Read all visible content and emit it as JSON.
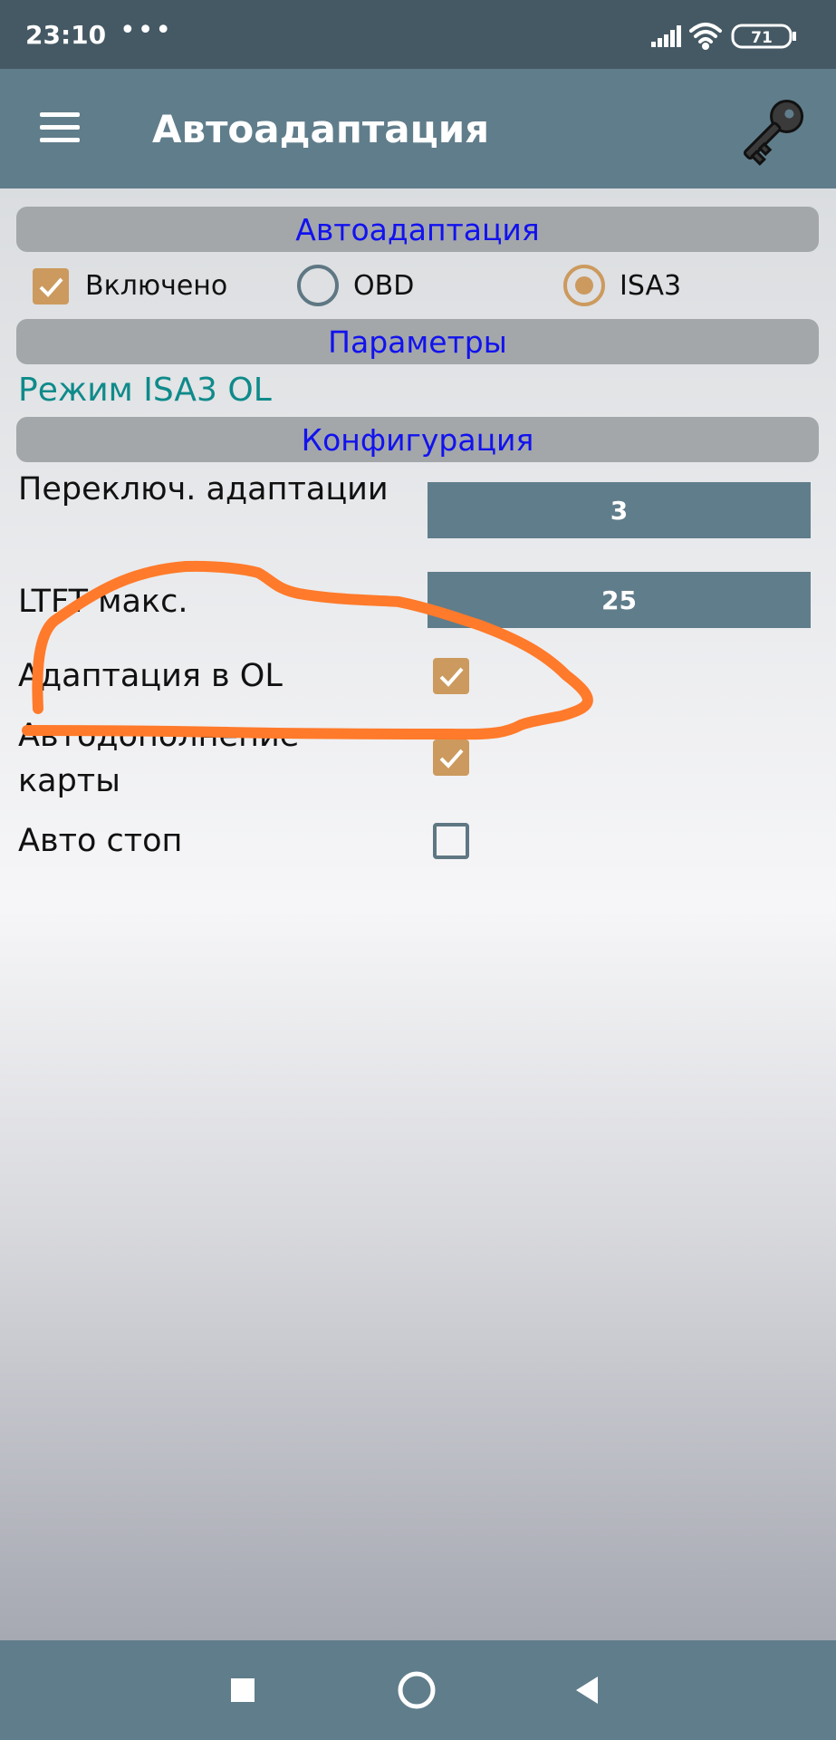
{
  "status_bar": {
    "time": "23:10",
    "dots": "•••",
    "battery": "71"
  },
  "app_bar": {
    "title": "Автоадаптация",
    "menu_icon": "hamburger-menu-icon",
    "action_icon": "key-icon"
  },
  "sections": {
    "autoadapt": "Автоадаптация",
    "params": "Параметры",
    "config": "Конфигурация"
  },
  "enable_row": {
    "enabled_label": "Включено",
    "enabled_checked": true,
    "obd_label": "OBD",
    "obd_selected": false,
    "isa3_label": "ISA3",
    "isa3_selected": true
  },
  "mode_text": "Режим ISA3 OL",
  "config": {
    "switch_label": "Переключ. адаптации",
    "switch_value": "3",
    "ltft_label": "LTFT макс.",
    "ltft_value": "25",
    "ol_label": "Адаптация в OL",
    "ol_checked": true,
    "map_label_line1": "Автодополнение",
    "map_label_line2": "карты",
    "map_checked": true,
    "autostop_label": "Авто стоп",
    "autostop_checked": false
  },
  "colors": {
    "app_bar": "#607d8b",
    "status_bar": "#455964",
    "accent": "#cc9a5e",
    "section_text": "#1212ee",
    "mode_text": "#0f8a8a",
    "annotation": "#ff7a2a"
  }
}
